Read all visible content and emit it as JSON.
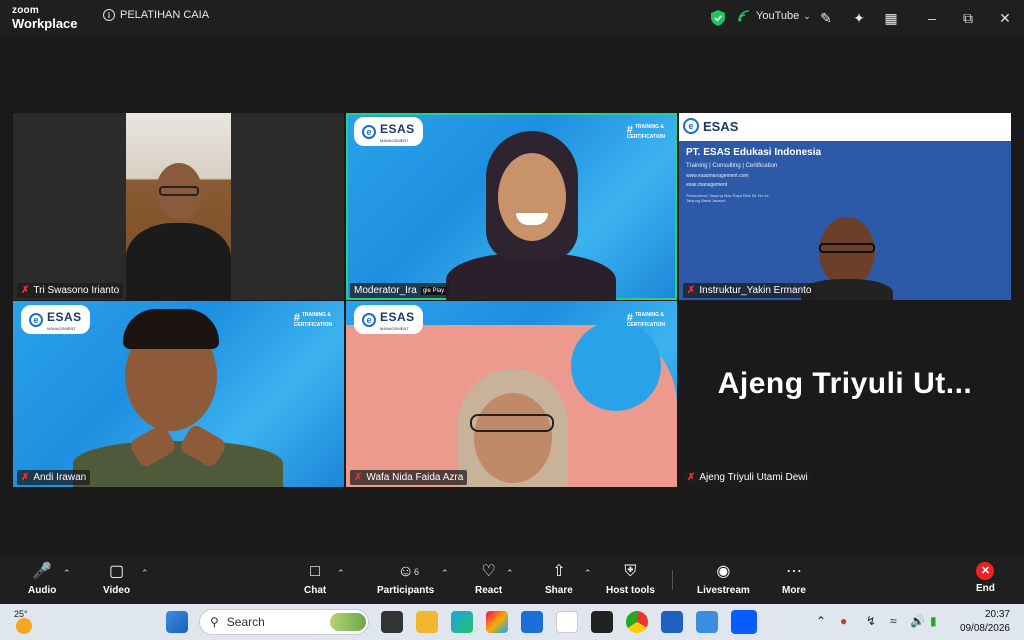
{
  "window": {
    "app_name_top": "zoom",
    "app_name_bottom": "Workplace",
    "meeting_title": "PELATIHAN CAIA",
    "livestream_target": "YouTube"
  },
  "tiles": [
    {
      "name": "Tri Swasono Irianto"
    },
    {
      "name": "Moderator_Ira",
      "overlay_hint": "gle Play"
    },
    {
      "name": "Instruktur_Yakin Ermanto"
    },
    {
      "name": "Andi Irawan"
    },
    {
      "name": "Wafa Nida Faida Azra"
    },
    {
      "name": "Ajeng Triyuli Utami Dewi",
      "display_name": "Ajeng Triyuli Ut..."
    }
  ],
  "branding": {
    "logo_text": "ESAS",
    "logo_sub": "MANAGEMENT",
    "training_hash": "#",
    "training_line1": "TRAINING &",
    "training_line2": "CERTIFICATION",
    "company_title": "PT. ESAS Edukasi Indonesia",
    "company_services": "Training | Consulting | Certification",
    "company_web": "www.esasmanagement.com",
    "company_ig": "esas.management",
    "company_address": "Perkantoran Tanjung Mas Raya Blok B1 No.44 Tanjung Barat Jakasel"
  },
  "toolbar": {
    "audio": "Audio",
    "video": "Video",
    "chat": "Chat",
    "participants": "Participants",
    "participants_count": "6",
    "react": "React",
    "share": "Share",
    "host_tools": "Host tools",
    "livestream": "Livestream",
    "more": "More",
    "end": "End"
  },
  "taskbar": {
    "temperature": "25°",
    "search_placeholder": "Search",
    "time": "20:37",
    "date": "09/08/2026"
  },
  "colors": {
    "active_speaker_border": "#23d18b",
    "end_red": "#e22222",
    "brand_blue": "#1d6fc4"
  }
}
